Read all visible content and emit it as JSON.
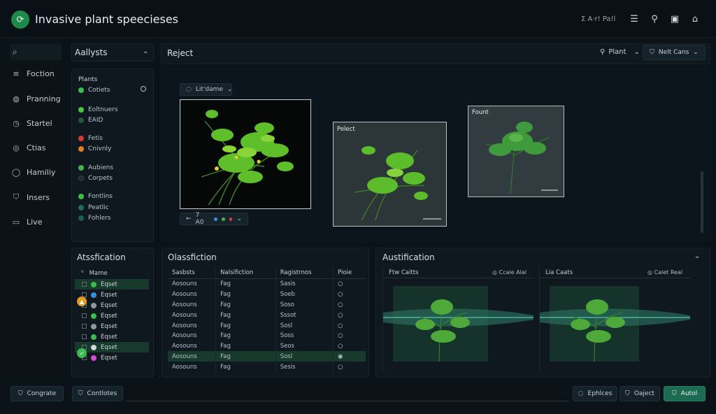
{
  "header": {
    "app_title": "Invasive plant speecieses",
    "user_label": "Σ  A·r! Pa!l"
  },
  "sidebar": {
    "items": [
      {
        "label": "Foction"
      },
      {
        "label": "Pranning"
      },
      {
        "label": "Startel"
      },
      {
        "label": "Ctias"
      },
      {
        "label": "Hamiliy"
      },
      {
        "label": "Insers"
      },
      {
        "label": "Live"
      }
    ]
  },
  "analysis": {
    "title": "Aallysts",
    "section_label": "Plants",
    "items": [
      {
        "label": "Cotiets",
        "color": "#3dbb4c",
        "has_radio": true
      },
      {
        "label": "Eoltnuers",
        "color": "#4fc440"
      },
      {
        "label": "EAID",
        "color": "#1e5a3e"
      },
      {
        "label": "Fetis",
        "color": "#d33a3a"
      },
      {
        "label": "Cnivnly",
        "color": "#e07d24"
      },
      {
        "label": "Aubiens",
        "color": "#44b54a"
      },
      {
        "label": "Corpets",
        "color": "#1a2a30"
      },
      {
        "label": "Fontlins",
        "color": "#3fbf42"
      },
      {
        "label": "Peatlic",
        "color": "#1f6a58"
      },
      {
        "label": "Fohlers",
        "color": "#1b5e50"
      }
    ]
  },
  "reject_panel": {
    "title": "Reject",
    "plant_button": "Plant",
    "main_button": "Nelt Cans",
    "chip_top": "Lit'dame",
    "chip_bottom": "7 A0",
    "card2_label": "Pelect",
    "card3_label": "Fount"
  },
  "attribution": {
    "title": "Atssfication",
    "column": "Mame",
    "rows": [
      {
        "label": "Eqset",
        "color": "#3dbb4c",
        "selected": true
      },
      {
        "label": "Eqset",
        "color": "#3a8fd6"
      },
      {
        "label": "Eqset",
        "color": "#8a9aa2"
      },
      {
        "label": "Eqset",
        "color": "#3dbb4c"
      },
      {
        "label": "Eqset",
        "color": "#8a9aa2"
      },
      {
        "label": "Eqset",
        "color": "#3dbb4c"
      },
      {
        "label": "Eqset",
        "color": "#cfd8dc",
        "selected": true
      },
      {
        "label": "Eqset",
        "color": "#d04ed0"
      }
    ]
  },
  "classification": {
    "title": "Olassfiction",
    "columns": [
      "Sasbsts",
      "Nalsifiction",
      "Ragistrnos",
      "Pioie"
    ],
    "rows": [
      [
        "Aosouns",
        "Fag",
        "Sasis"
      ],
      [
        "Aosouns",
        "Fag",
        "Soeb"
      ],
      [
        "Aosouns",
        "Fag",
        "Soso"
      ],
      [
        "Aosouns",
        "Fag",
        "Sssot"
      ],
      [
        "Aosouns",
        "Fag",
        "Sosl"
      ],
      [
        "Aosouns",
        "Fag",
        "Soss"
      ],
      [
        "Aosouns",
        "Fag",
        "Seos"
      ],
      [
        "Aosouns",
        "Fag",
        "Sosl"
      ],
      [
        "Aosouns",
        "Fag",
        "Sesis"
      ]
    ],
    "selected_row": 8
  },
  "austification": {
    "title": "Austification",
    "left_label": "Ftw Caitts",
    "left_badge": "Ccaie Alal",
    "right_label": "Lia Caats",
    "right_badge": "Calet Real"
  },
  "footer": {
    "btn_left1": "Congrate",
    "btn_left2": "Contlotes",
    "btn_right1": "Ephlces",
    "btn_right2": "Oaject",
    "btn_primary": "Autol"
  }
}
